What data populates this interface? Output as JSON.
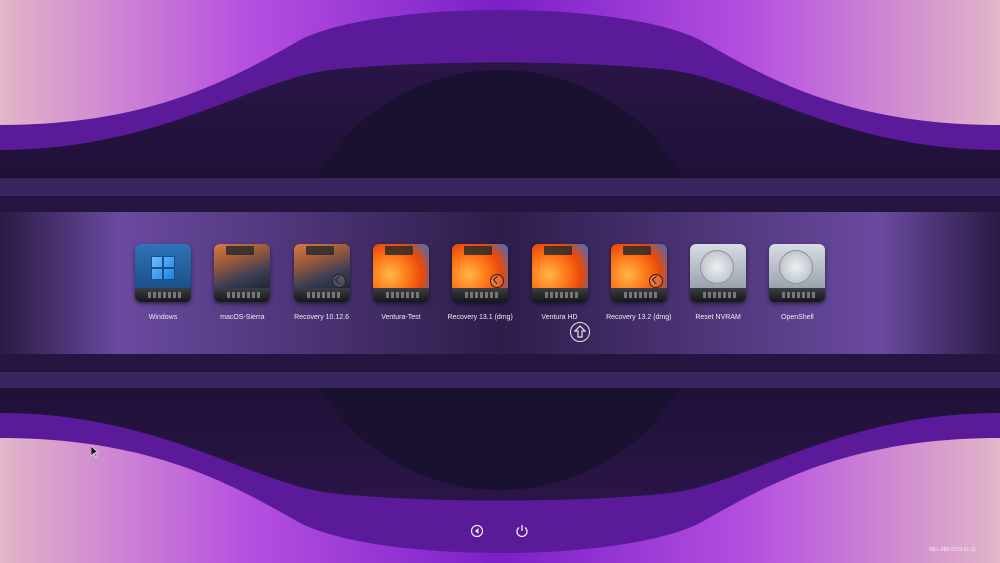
{
  "boot_entries": [
    {
      "label": "Windows",
      "icon": "windows-drive-icon",
      "style": "windows"
    },
    {
      "label": "macOS-Sierra",
      "icon": "sierra-drive-icon",
      "style": "sierra"
    },
    {
      "label": "Recovery 10.12.6",
      "icon": "sierra-recovery-drive-icon",
      "style": "sierra",
      "badge": true
    },
    {
      "label": "Ventura-Test",
      "icon": "ventura-drive-icon",
      "style": "ventura"
    },
    {
      "label": "Recovery 13.1 (dmg)",
      "icon": "ventura-recovery-drive-icon",
      "style": "ventura",
      "badge": true
    },
    {
      "label": "Ventura HD",
      "icon": "ventura-drive-icon",
      "style": "ventura",
      "selected": true
    },
    {
      "label": "Recovery 13.2 (dmg)",
      "icon": "ventura-recovery-drive-icon",
      "style": "ventura",
      "badge": true
    },
    {
      "label": "Reset NVRAM",
      "icon": "reset-nvram-icon",
      "style": "tool"
    },
    {
      "label": "OpenShell",
      "icon": "openshell-icon",
      "style": "tool"
    }
  ],
  "controls": {
    "restart_icon": "restart-icon",
    "shutdown_icon": "power-icon"
  },
  "release_text": "REL-089-2023-01-11",
  "colors": {
    "accent": "#a12ee6",
    "band": "#3b2460",
    "dark": "#17102a"
  }
}
